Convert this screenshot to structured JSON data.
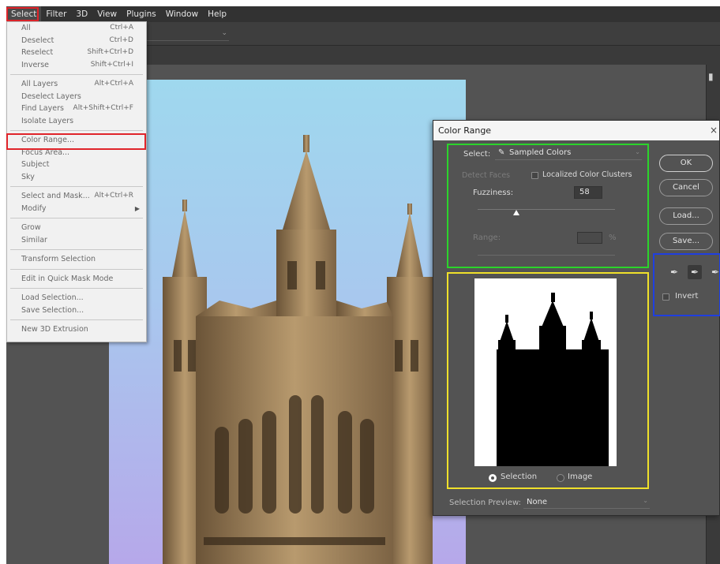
{
  "menubar": {
    "items": [
      "Select",
      "Filter",
      "3D",
      "View",
      "Plugins",
      "Window",
      "Help"
    ],
    "active": "Select"
  },
  "select_menu": {
    "groups": [
      [
        {
          "label": "All",
          "shortcut": "Ctrl+A"
        },
        {
          "label": "Deselect",
          "shortcut": "Ctrl+D"
        },
        {
          "label": "Reselect",
          "shortcut": "Shift+Ctrl+D"
        },
        {
          "label": "Inverse",
          "shortcut": "Shift+Ctrl+I"
        }
      ],
      [
        {
          "label": "All Layers",
          "shortcut": "Alt+Ctrl+A"
        },
        {
          "label": "Deselect Layers",
          "shortcut": ""
        },
        {
          "label": "Find Layers",
          "shortcut": "Alt+Shift+Ctrl+F"
        },
        {
          "label": "Isolate Layers",
          "shortcut": ""
        }
      ],
      [
        {
          "label": "Color Range...",
          "shortcut": ""
        },
        {
          "label": "Focus Area...",
          "shortcut": ""
        },
        {
          "label": "Subject",
          "shortcut": ""
        },
        {
          "label": "Sky",
          "shortcut": ""
        }
      ],
      [
        {
          "label": "Select and Mask...",
          "shortcut": "Alt+Ctrl+R"
        },
        {
          "label": "Modify",
          "shortcut": "",
          "submenu": true
        }
      ],
      [
        {
          "label": "Grow",
          "shortcut": ""
        },
        {
          "label": "Similar",
          "shortcut": ""
        }
      ],
      [
        {
          "label": "Transform Selection",
          "shortcut": ""
        }
      ],
      [
        {
          "label": "Edit in Quick Mask Mode",
          "shortcut": ""
        }
      ],
      [
        {
          "label": "Load Selection...",
          "shortcut": ""
        },
        {
          "label": "Save Selection...",
          "shortcut": ""
        }
      ],
      [
        {
          "label": "New 3D Extrusion",
          "shortcut": ""
        }
      ]
    ]
  },
  "dialog": {
    "title": "Color Range",
    "close": "×",
    "select_label": "Select:",
    "select_value": "Sampled Colors",
    "detect_faces": "Detect Faces",
    "localized_clusters": "Localized Color Clusters",
    "fuzziness_label": "Fuzziness:",
    "fuzziness_value": "58",
    "range_label": "Range:",
    "range_unit": "%",
    "buttons": {
      "ok": "OK",
      "cancel": "Cancel",
      "load": "Load...",
      "save": "Save..."
    },
    "invert_label": "Invert",
    "radio_selection": "Selection",
    "radio_image": "Image",
    "preview_label": "Selection Preview:",
    "preview_value": "None"
  },
  "colors": {
    "highlight_red": "#e0242a",
    "highlight_green": "#2bd42b",
    "highlight_yellow": "#f0e02a",
    "highlight_blue": "#1f3fe0",
    "panel_bg": "#535353"
  }
}
